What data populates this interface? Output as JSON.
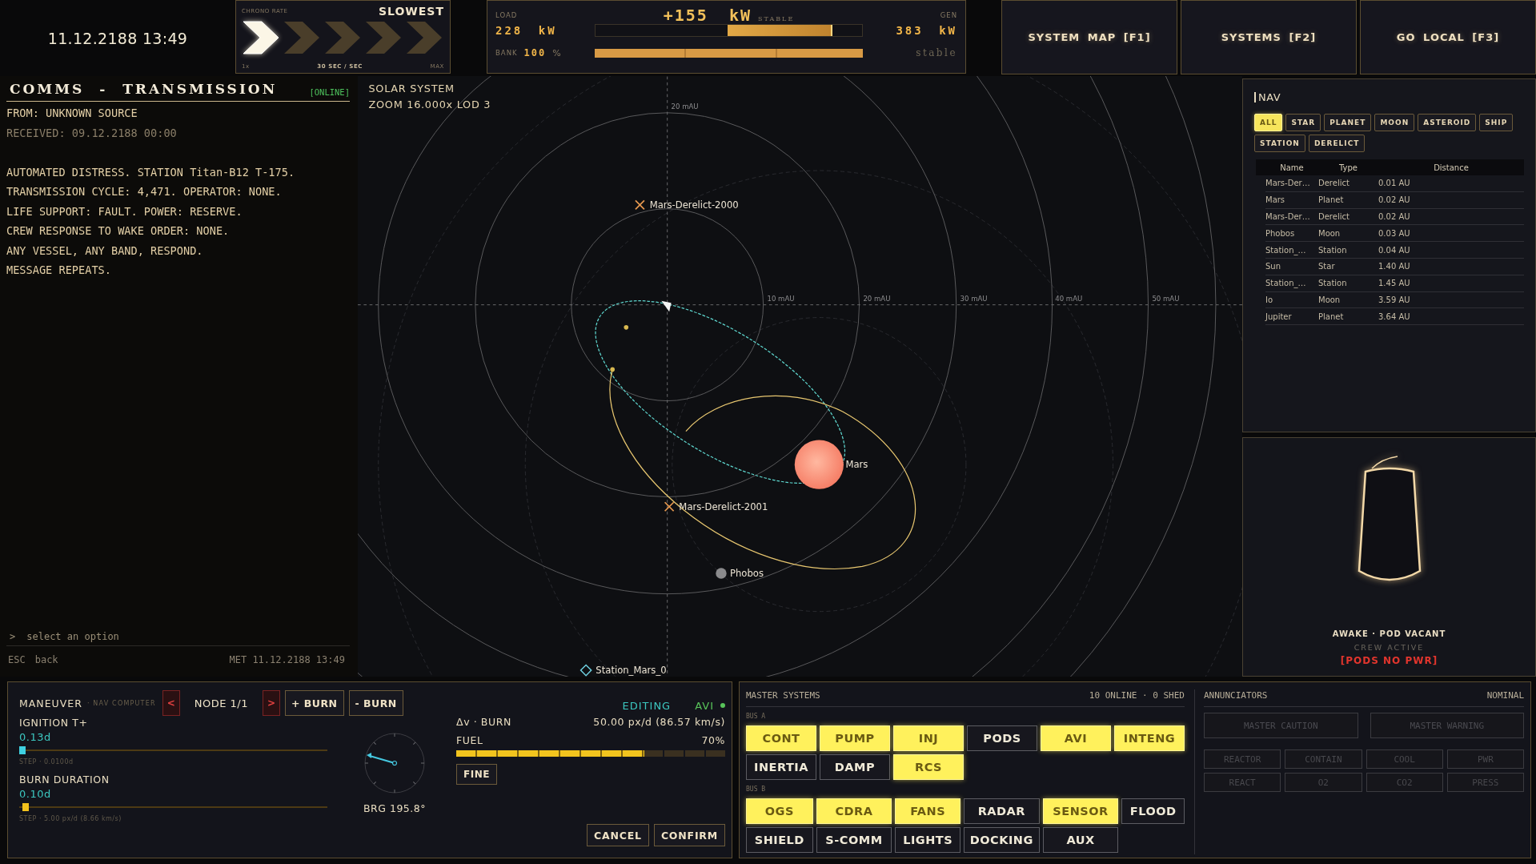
{
  "top_bar": {
    "clock": "11.12.2188 13:49",
    "chrono": {
      "label": "CHRONO RATE",
      "rate": "SLOWEST",
      "steps": [
        {
          "selected": true
        },
        {
          "selected": false
        },
        {
          "selected": false
        },
        {
          "selected": false
        },
        {
          "selected": false
        }
      ],
      "min_label": "1x",
      "rate_label": "30 SEC / SEC",
      "max_label": "MAX"
    },
    "power": {
      "load_label": "LOAD",
      "net": "+155 kW",
      "net_status": "STABLE",
      "gen_label": "GEN",
      "load": "228 kW",
      "load_bar": {
        "level": 0.89
      },
      "gen": "383 kW",
      "bank_label": "BANK",
      "bank_value": "100",
      "bank_unit": "%",
      "bank_bar": {
        "level": 1.0
      },
      "bank_status": "stable"
    },
    "buttons": [
      {
        "label": "SYSTEM MAP [F1]"
      },
      {
        "label": "SYSTEMS [F2]"
      },
      {
        "label": "GO LOCAL [F3]"
      }
    ]
  },
  "comms": {
    "title": "COMMS - TRANSMISSION",
    "status": "[ONLINE]",
    "from": "FROM: UNKNOWN SOURCE",
    "received": "RECEIVED: 09.12.2188 00:00",
    "message": [
      "AUTOMATED DISTRESS. STATION Titan-B12 T-175.",
      "TRANSMISSION CYCLE: 4,471. OPERATOR: NONE.",
      "LIFE SUPPORT: FAULT. POWER: RESERVE.",
      "CREW RESPONSE TO WAKE ORDER: NONE.",
      "ANY VESSEL, ANY BAND, RESPOND.",
      "MESSAGE REPEATS."
    ],
    "prompt_marker": ">",
    "prompt": "select an option",
    "footer_key": "ESC",
    "footer_action": "back",
    "footer_time": "MET 11.12.2188 13:49"
  },
  "map": {
    "title": "SOLAR SYSTEM",
    "zoom": "ZOOM 16.000x LOD 3",
    "ring_label": "20 mAU",
    "axis_labels": [
      "10 mAU",
      "20 mAU",
      "30 mAU",
      "40 mAU",
      "50 mAU"
    ],
    "bodies": [
      {
        "name": "Mars-Derelict-2000",
        "kind": "derelict"
      },
      {
        "name": "Mars",
        "kind": "planet"
      },
      {
        "name": "Mars-Derelict-2001",
        "kind": "derelict"
      },
      {
        "name": "Phobos",
        "kind": "moon"
      },
      {
        "name": "Station_Mars_0",
        "kind": "station"
      }
    ]
  },
  "nav": {
    "title": "NAV",
    "filters": [
      {
        "label": "ALL",
        "selected": true
      },
      {
        "label": "STAR",
        "selected": false
      },
      {
        "label": "PLANET",
        "selected": false
      },
      {
        "label": "MOON",
        "selected": false
      },
      {
        "label": "ASTEROID",
        "selected": false
      },
      {
        "label": "SHIP",
        "selected": false
      },
      {
        "label": "STATION",
        "selected": false
      },
      {
        "label": "DERELICT",
        "selected": false
      }
    ],
    "columns": [
      "Name",
      "Type",
      "Distance"
    ],
    "rows": [
      [
        "Mars-Der…",
        "Derelict",
        "0.01 AU"
      ],
      [
        "Mars",
        "Planet",
        "0.02 AU"
      ],
      [
        "Mars-Der…",
        "Derelict",
        "0.02 AU"
      ],
      [
        "Phobos",
        "Moon",
        "0.03 AU"
      ],
      [
        "Station_…",
        "Station",
        "0.04 AU"
      ],
      [
        "Sun",
        "Star",
        "1.40 AU"
      ],
      [
        "Station_…",
        "Station",
        "1.45 AU"
      ],
      [
        "Io",
        "Moon",
        "3.59 AU"
      ],
      [
        "Jupiter",
        "Planet",
        "3.64 AU"
      ]
    ]
  },
  "pod": {
    "status": "AWAKE · POD VACANT",
    "crew": "CREW ACTIVE",
    "alert": "[PODS NO PWR]"
  },
  "maneuver": {
    "title": "MANEUVER",
    "subtitle": "· NAV COMPUTER",
    "prev": "<",
    "node": "NODE 1/1",
    "next": ">",
    "add_burn": "+ BURN",
    "remove_burn": "- BURN",
    "mode": "EDITING",
    "system": "AVI",
    "sliders": [
      {
        "label": "IGNITION T+",
        "value": "0.13d",
        "level": 0.01,
        "active": true,
        "step": "STEP · 0.0100d"
      },
      {
        "label": "BURN DURATION",
        "value": "0.10d",
        "level": 0.02,
        "active": false,
        "step": "STEP · 5.00 px/d (8.66 km/s)"
      }
    ],
    "bearing": "BRG 195.8°",
    "dv_label": "Δv · BURN",
    "dv_value": "50.00 px/d (86.57 km/s)",
    "fuel_label": "FUEL",
    "fuel_value": "70%",
    "fuel": {
      "level": 0.7
    },
    "fine": "FINE",
    "cancel": "CANCEL",
    "confirm": "CONFIRM"
  },
  "systems": {
    "title": "MASTER SYSTEMS",
    "summary": "10 ONLINE · 0 SHED",
    "buses": [
      {
        "label": "BUS A",
        "items": [
          {
            "label": "CONT",
            "on": true
          },
          {
            "label": "PUMP",
            "on": true
          },
          {
            "label": "INJ",
            "on": true
          },
          {
            "label": "PODS",
            "on": false
          },
          {
            "label": "AVI",
            "on": true
          },
          {
            "label": "INTENG",
            "on": true
          },
          {
            "label": "INERTIA",
            "on": false
          },
          {
            "label": "DAMP",
            "on": false
          },
          {
            "label": "RCS",
            "on": true
          }
        ]
      },
      {
        "label": "BUS B",
        "items": [
          {
            "label": "OGS",
            "on": true
          },
          {
            "label": "CDRA",
            "on": true
          },
          {
            "label": "FANS",
            "on": true
          },
          {
            "label": "RADAR",
            "on": false
          },
          {
            "label": "SENSOR",
            "on": true
          },
          {
            "label": "FLOOD",
            "on": false
          },
          {
            "label": "SHIELD",
            "on": false
          },
          {
            "label": "S-COMM",
            "on": false
          },
          {
            "label": "LIGHTS",
            "on": false
          },
          {
            "label": "DOCKING",
            "on": false
          },
          {
            "label": "AUX",
            "on": false
          }
        ]
      }
    ]
  },
  "annunciators": {
    "title": "ANNUNCIATORS",
    "status": "NOMINAL",
    "masters": [
      {
        "label": "MASTER CAUTION",
        "lit": false
      },
      {
        "label": "MASTER WARNING",
        "lit": false
      }
    ],
    "lights": [
      {
        "label": "REACTOR",
        "lit": false
      },
      {
        "label": "CONTAIN",
        "lit": false
      },
      {
        "label": "COOL",
        "lit": false
      },
      {
        "label": "PWR",
        "lit": false
      },
      {
        "label": "REACT",
        "lit": false
      },
      {
        "label": "O2",
        "lit": false
      },
      {
        "label": "CO2",
        "lit": false
      },
      {
        "label": "PRESS",
        "lit": false
      }
    ]
  }
}
